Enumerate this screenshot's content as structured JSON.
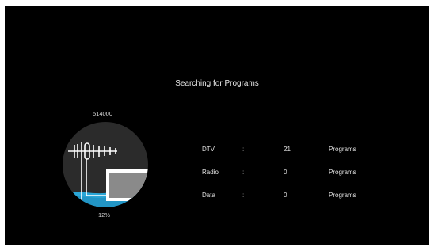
{
  "screen": {
    "title": "Searching for Programs",
    "frequency": "514000",
    "progress_text": "12%",
    "progress": 0.12
  },
  "results": [
    {
      "label": "DTV",
      "separator": ":",
      "count": "21",
      "unit": "Programs"
    },
    {
      "label": "Radio",
      "separator": ":",
      "count": "0",
      "unit": "Programs"
    },
    {
      "label": "Data",
      "separator": ":",
      "count": "0",
      "unit": "Programs"
    }
  ],
  "colors": {
    "background": "#000000",
    "circle": "#2b2b2b",
    "progress_water": "#2aa6d6",
    "text": "#e6e6e6"
  },
  "icons": {
    "scan": "antenna-tv-icon"
  }
}
